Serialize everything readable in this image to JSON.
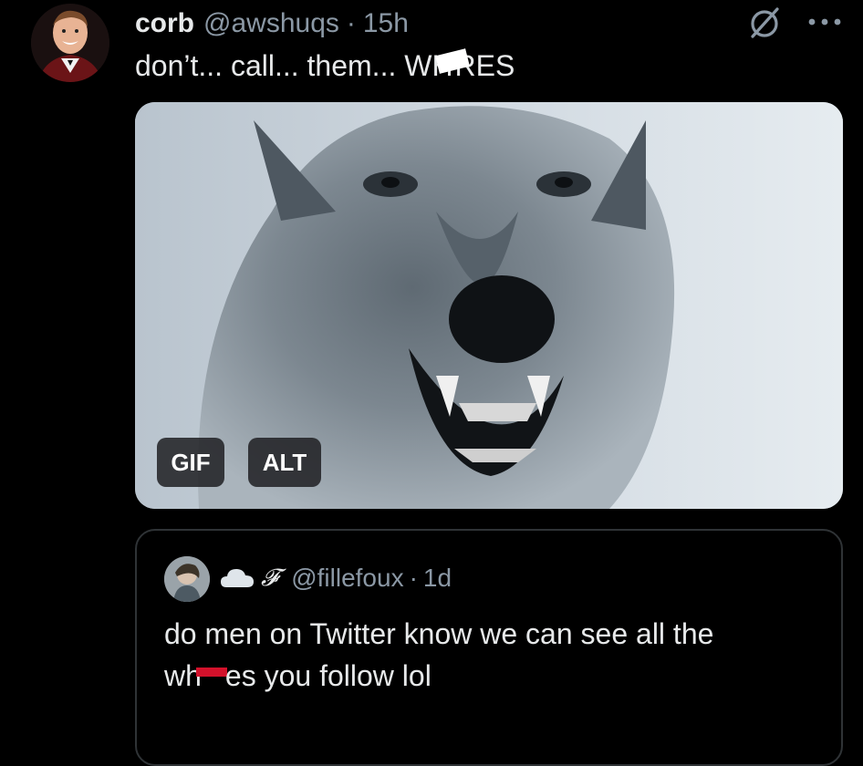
{
  "tweet": {
    "author_name": "corb",
    "author_handle": "@awshuqs",
    "separator": "·",
    "time": "15h",
    "text_before": "don’t... call... them... WH",
    "text_after": "RES",
    "media": {
      "gif_label": "GIF",
      "alt_label": "ALT",
      "icon": "wolf-gif-image"
    }
  },
  "quoted_tweet": {
    "author_name": "𝓕",
    "author_handle": "@fillefoux",
    "separator": "·",
    "time": "1d",
    "text_line1": "do men on Twitter know we can see all the",
    "text_line2_before": "wh",
    "text_line2_after": "es you follow lol"
  },
  "icons": {
    "grok": "grok-icon",
    "more": "more-icon",
    "cloud": "cloud-icon"
  },
  "colors": {
    "background": "#000000",
    "text": "#e7e9ea",
    "secondary_text": "#8b98a5",
    "border": "#2f3336",
    "redaction_white": "#ffffff",
    "redaction_red": "#d3112b"
  }
}
